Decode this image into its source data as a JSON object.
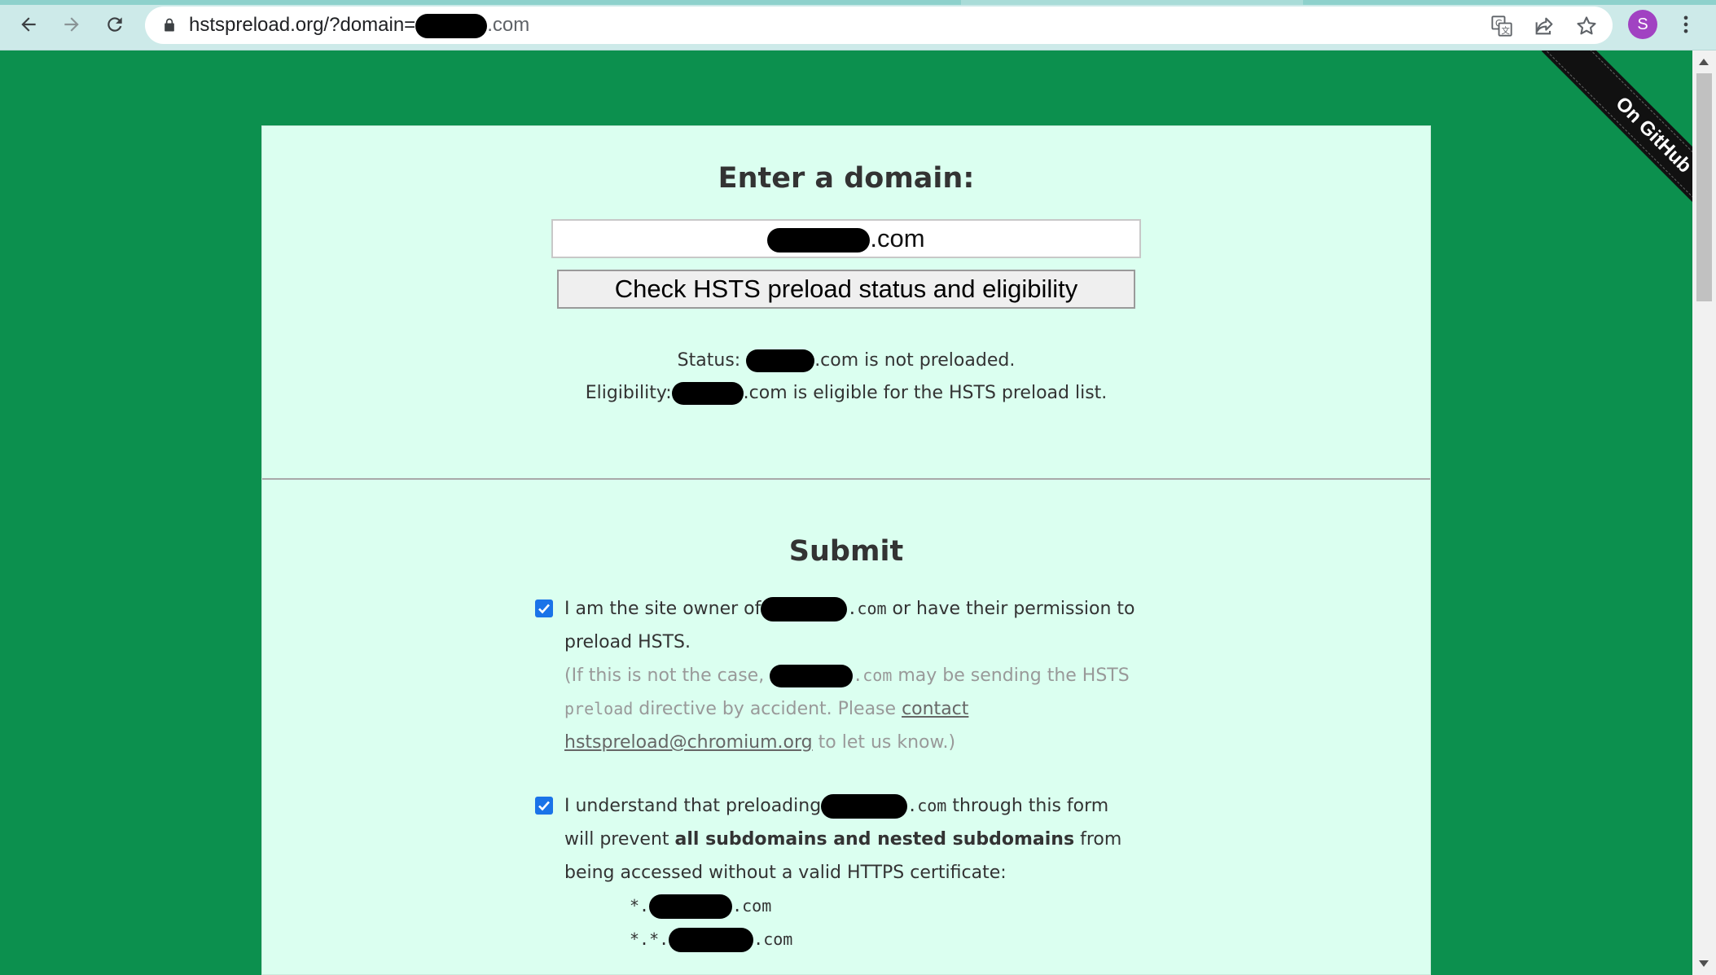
{
  "browser": {
    "url_host": "hstspreload.org/?domain=",
    "url_suffix": ".com",
    "profile_initial": "S"
  },
  "ribbon": {
    "label": "On GitHub"
  },
  "checker": {
    "heading": "Enter a domain:",
    "input_suffix": ".com",
    "button_label": "Check HSTS preload status and eligibility",
    "status_prefix": "Status: ",
    "status_suffix": ".com is not preloaded.",
    "eligibility_prefix": "Eligibility:",
    "eligibility_suffix": ".com is eligible for the HSTS preload list."
  },
  "submit": {
    "heading": "Submit",
    "owner": {
      "text_before": "I am the site owner of",
      "domain_suffix": ".com",
      "text_after": " or have their permission to preload HSTS.",
      "note_before": "(If this is not the case, ",
      "note_domain_suffix": ".com",
      "note_mid": " may be sending the HSTS ",
      "note_code": "preload",
      "note_after": " directive by accident. Please ",
      "contact_link": "contact hstspreload@chromium.org",
      "note_end": " to let us know.)"
    },
    "subdomains": {
      "text_before": "I understand that preloading",
      "domain_suffix": ".com",
      "text_mid": " through this form will prevent ",
      "bold": "all subdomains and nested subdomains",
      "text_after": " from being accessed without a valid HTTPS certificate:",
      "item1_prefix": "*.",
      "item1_suffix": ".com",
      "item2_prefix": "*.*.",
      "item2_suffix": ".com"
    }
  }
}
